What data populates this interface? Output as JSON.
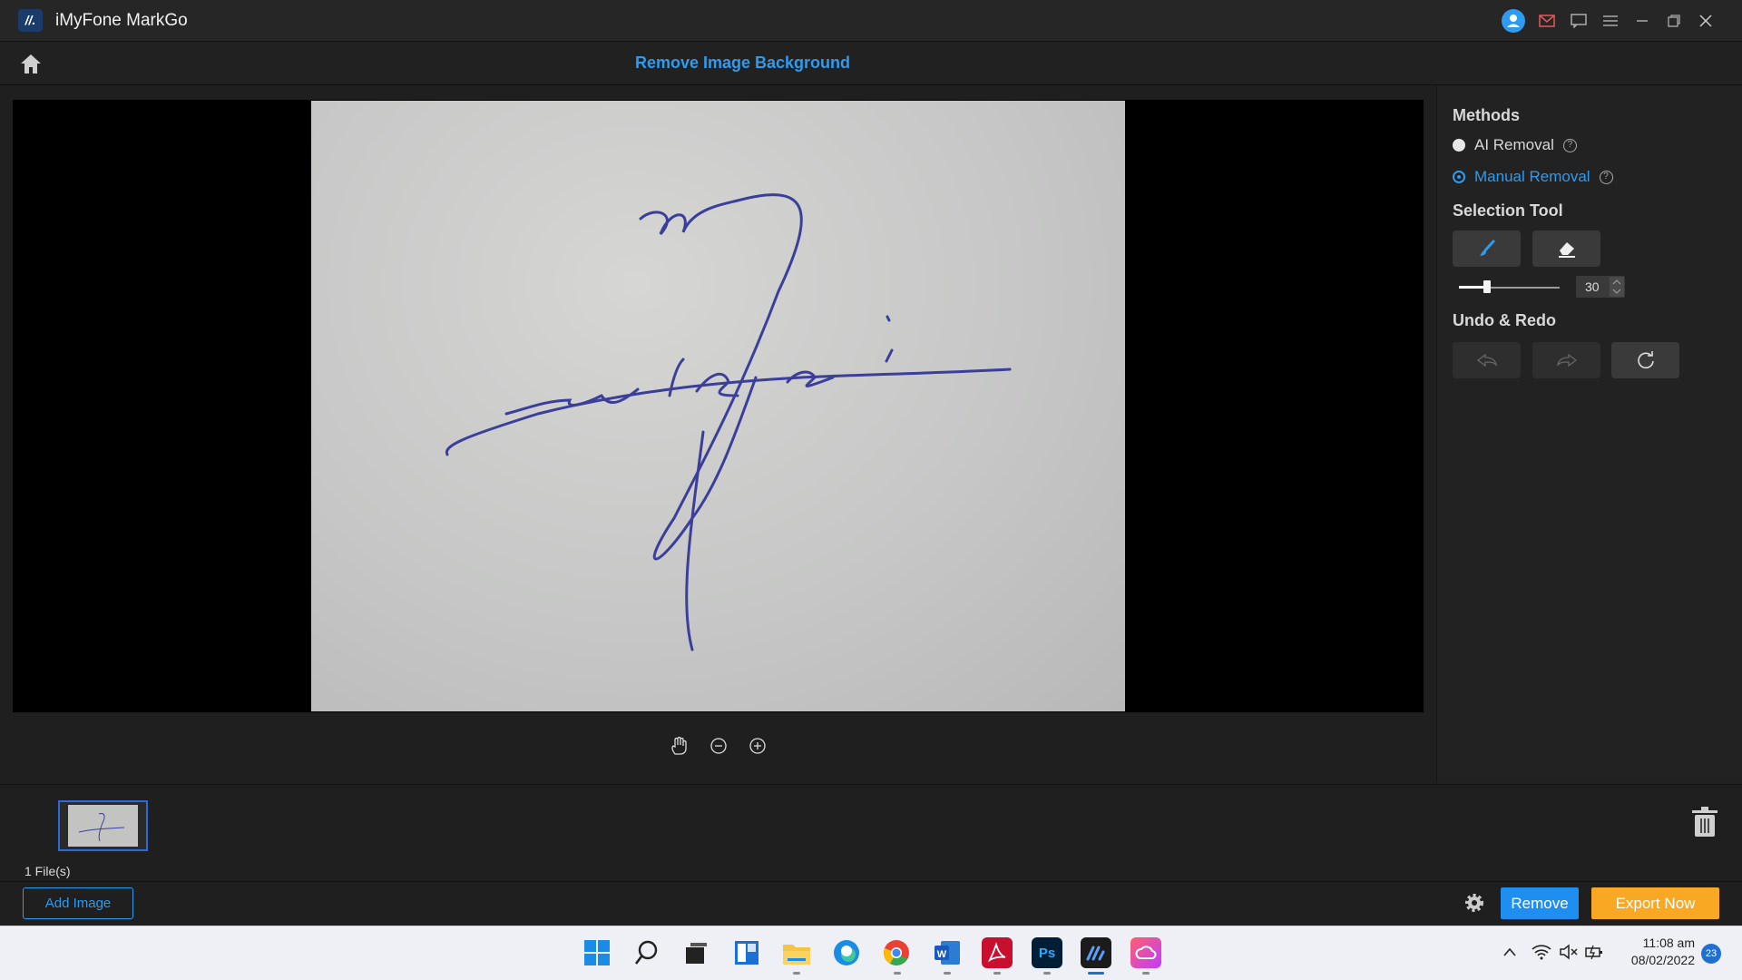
{
  "app": {
    "title": "iMyFone MarkGo",
    "logo_text": "//."
  },
  "header": {
    "page_title": "Remove Image Background"
  },
  "titlebar_icons": [
    "user-icon",
    "mail-icon",
    "feedback-icon",
    "menu-icon",
    "minimize-icon",
    "restore-icon",
    "close-icon"
  ],
  "canvas": {
    "signature_text": "mirza"
  },
  "zoom_tools": [
    "hand-icon",
    "zoom-out-icon",
    "zoom-in-icon"
  ],
  "panel": {
    "methods_title": "Methods",
    "methods": [
      {
        "label": "AI Removal",
        "selected": false
      },
      {
        "label": "Manual Removal",
        "selected": true
      }
    ],
    "selection_title": "Selection Tool",
    "brush_size": "30",
    "brush_fraction": 0.27,
    "undo_title": "Undo & Redo"
  },
  "files": {
    "count_label": "1 File(s)"
  },
  "footer": {
    "add_image": "Add Image",
    "remove": "Remove",
    "export": "Export Now"
  },
  "taskbar": {
    "time": "11:08 am",
    "date": "08/02/2022",
    "notifications": "23",
    "apps": [
      "start",
      "search",
      "task-view",
      "widgets",
      "file-explorer",
      "edge",
      "chrome",
      "word",
      "acrobat",
      "photoshop",
      "markgo",
      "creative-cloud"
    ]
  },
  "colors": {
    "accent": "#2d9bf0",
    "export": "#f9a824",
    "remove": "#1e8ef0"
  }
}
